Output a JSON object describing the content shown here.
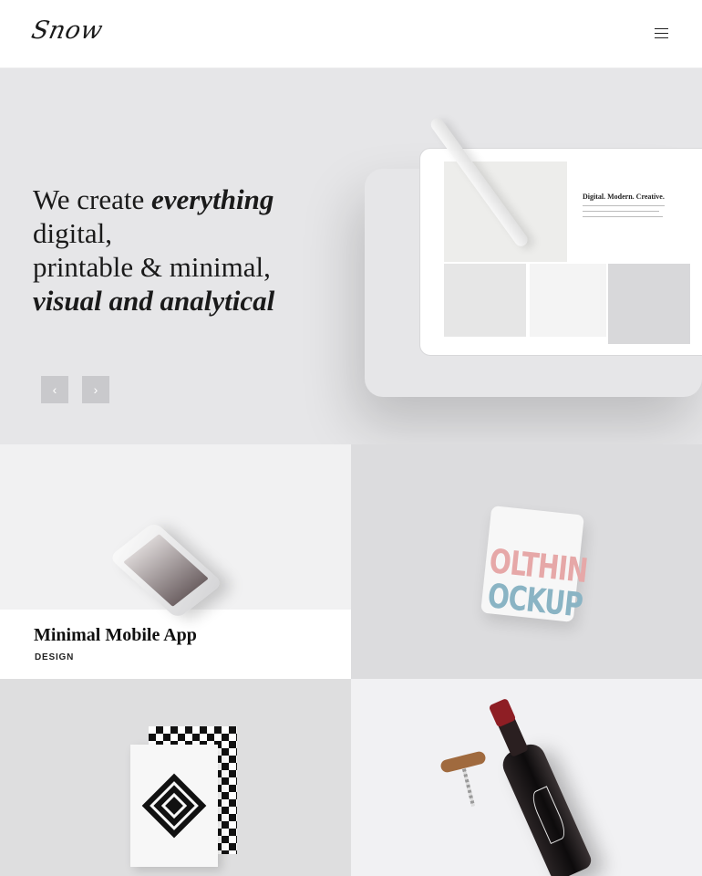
{
  "header": {
    "logo": "Snow",
    "menu_icon": "hamburger-menu-icon"
  },
  "hero": {
    "line1_plain": "We create ",
    "line1_em": "everything",
    "line2": "digital,",
    "line3": "printable & minimal,",
    "line4_em": "visual and analytical",
    "tablet_headline": "Digital. Modern. Creative.",
    "prev_icon": "chevron-left-icon",
    "next_icon": "chevron-right-icon",
    "prev_glyph": "‹",
    "next_glyph": "›"
  },
  "portfolio": {
    "items": [
      {
        "title": "Minimal Mobile App",
        "category": "DESIGN"
      },
      {
        "shirt_line1": "OLTHIN",
        "shirt_line2": "OCKUP"
      },
      {},
      {}
    ]
  },
  "colors": {
    "hero_bg": "#e6e6e8",
    "text": "#1a1a1a",
    "wine_cap": "#8e1e24"
  }
}
